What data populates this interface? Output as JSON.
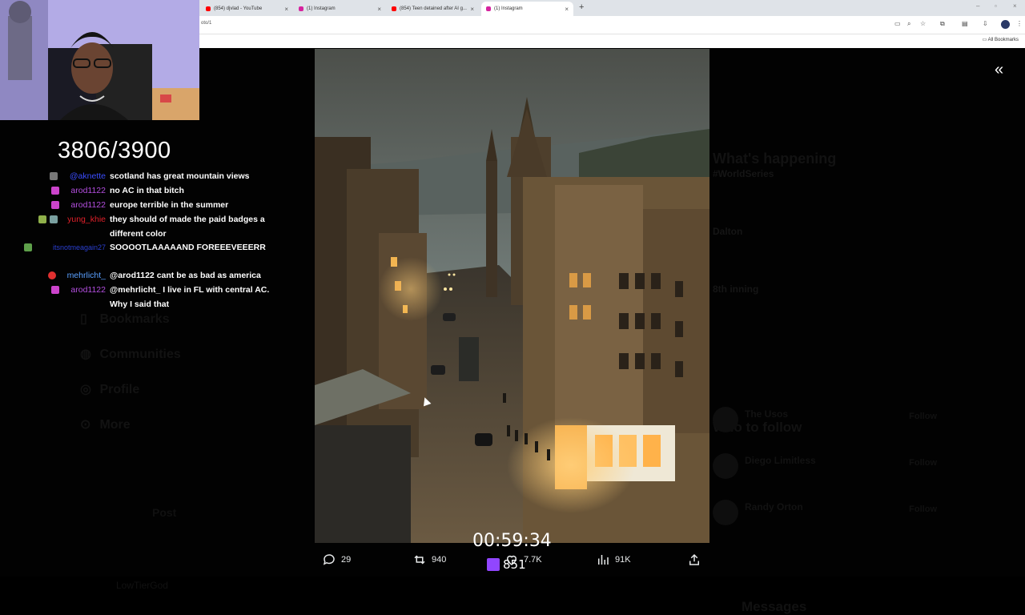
{
  "browser": {
    "tabs": [
      {
        "title": "(854) djvlad - YouTube",
        "favicon_color": "#ff0000",
        "active": false
      },
      {
        "title": "(1) Instagram",
        "favicon_color": "#d6249f",
        "active": false
      },
      {
        "title": "(854) Teen detained after AI g...",
        "favicon_color": "#ff0000",
        "active": false
      },
      {
        "title": "(1) Instagram",
        "favicon_color": "#d6249f",
        "active": true
      }
    ],
    "new_tab": "+",
    "url": "oto/1",
    "bookmarks_label": "All Bookmarks"
  },
  "stream": {
    "goal_counter": "3806/3900",
    "timer": "00:59:34",
    "sub_count": "851",
    "chat": [
      {
        "user": "@aknette",
        "user_color": "#3b4dff",
        "text": "scotland has great mountain views",
        "badges": [
          "#777777"
        ]
      },
      {
        "user": "arod1122",
        "user_color": "#b44fe0",
        "text": "no AC in that bitch",
        "badges": [
          "#cc44cc"
        ]
      },
      {
        "user": "arod1122",
        "user_color": "#b44fe0",
        "text": "europe terrible in the summer",
        "badges": [
          "#cc44cc"
        ]
      },
      {
        "user": "yung_khie",
        "user_color": "#e0202a",
        "text": "they should of made the paid badges a different color",
        "badges": [
          "#8fb04a",
          "#7aa0a0"
        ]
      },
      {
        "user": "itsnotmeagain27",
        "user_color": "#2a3fd0",
        "text": "SOOOOTLAAAAAND FOREEEVEEERR",
        "badges": [
          "#5ea04a"
        ]
      },
      {
        "user": "mehrlicht_",
        "user_color": "#5aa0ff",
        "text": "@arod1122 cant be as bad as america",
        "badges": [
          "#e03030"
        ]
      },
      {
        "user": "arod1122",
        "user_color": "#b44fe0",
        "text": "@mehrlicht_ I live in FL with central AC. Why I said that",
        "badges": [
          "#cc44cc"
        ]
      }
    ]
  },
  "tweet_actions": {
    "replies": "29",
    "reposts": "940",
    "likes": "7.7K",
    "views": "91K"
  },
  "background_twitter": {
    "nav": [
      "Bookmarks",
      "Communities",
      "Profile",
      "More"
    ],
    "post_button": "Post",
    "account_name": "LowTierGod",
    "whats_happening": "What's happening",
    "trends": [
      {
        "name": "#WorldSeries"
      },
      {
        "name": "Dalton"
      },
      {
        "name": "8th inning"
      }
    ],
    "who_to_follow": "Who to follow",
    "follow_suggestions": [
      {
        "name": "The Usos",
        "action": "Follow"
      },
      {
        "name": "Diego Limitless",
        "action": "Follow"
      },
      {
        "name": "Randy Orton",
        "action": "Follow"
      }
    ],
    "messages": "Messages"
  },
  "colors": {
    "accent_twitch": "#9146ff",
    "page_bg": "#000000"
  }
}
